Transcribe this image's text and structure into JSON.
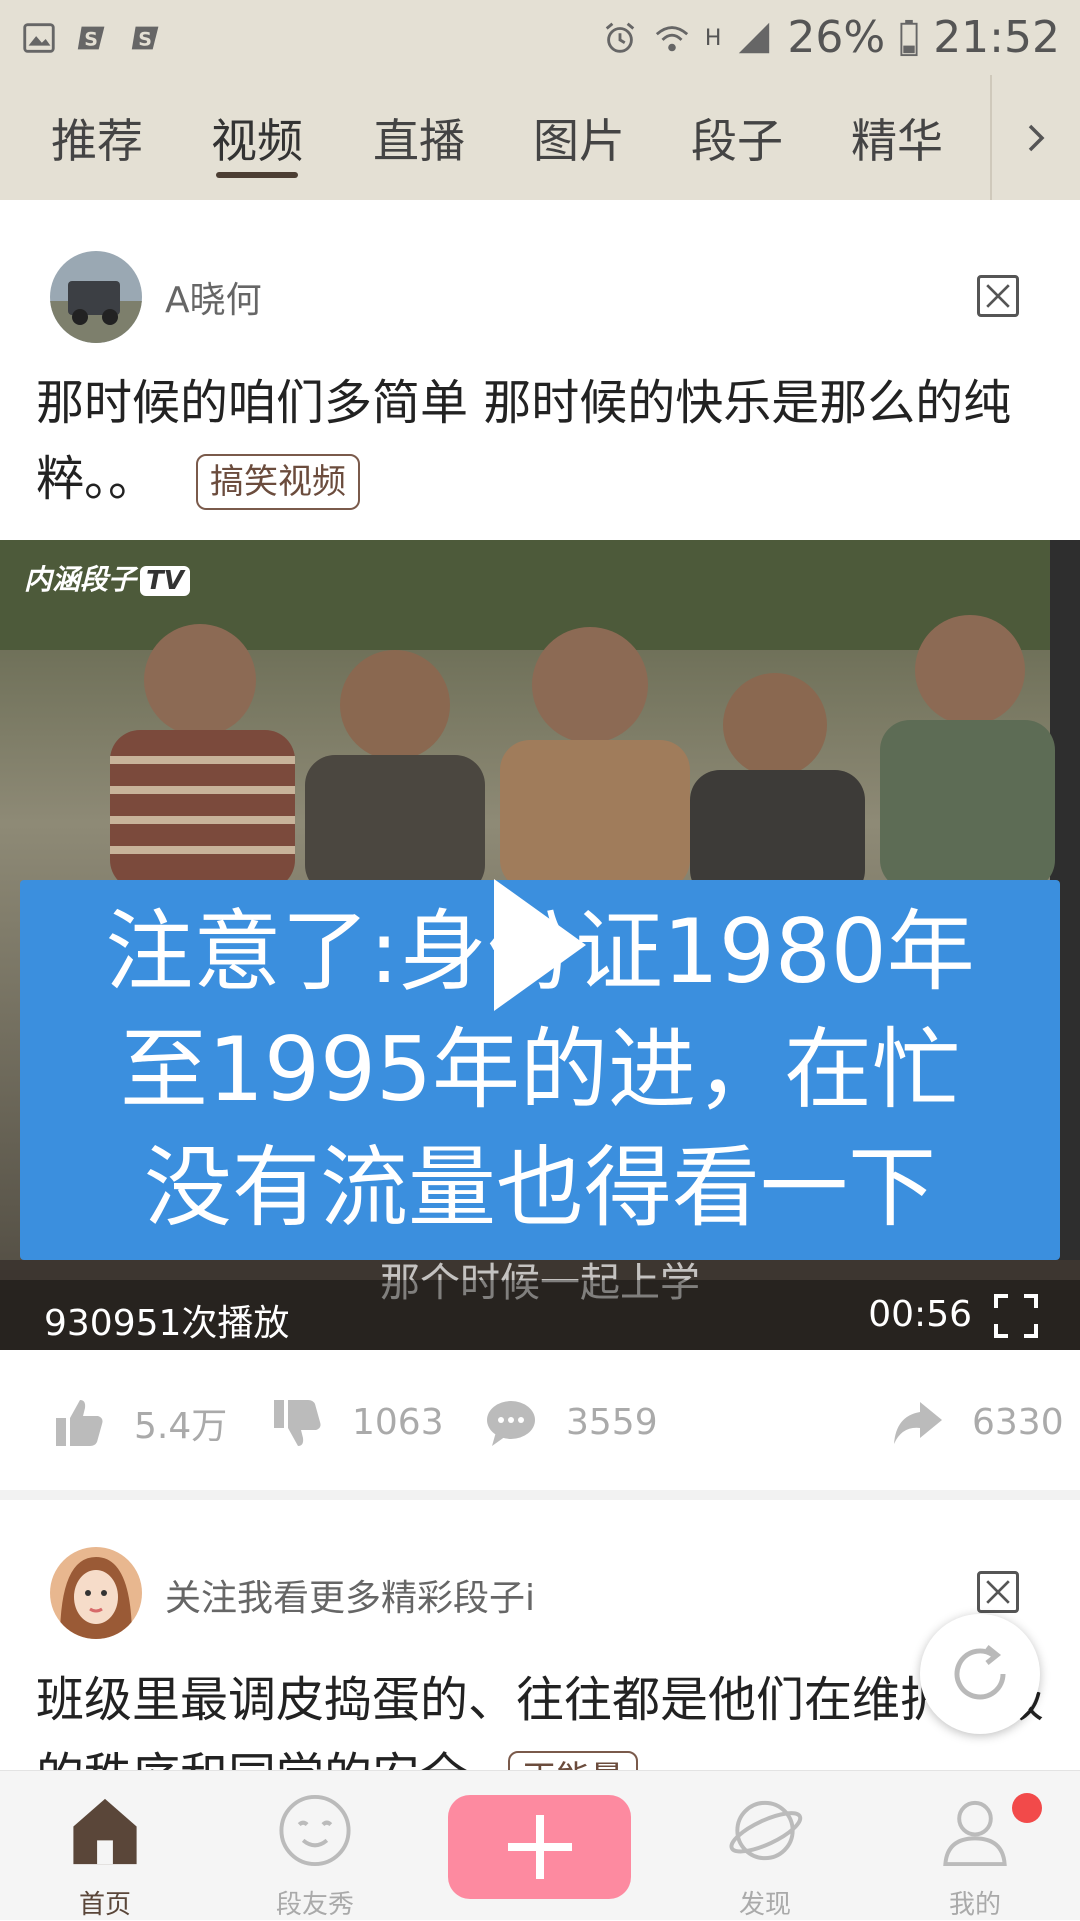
{
  "status_bar": {
    "battery": "26%",
    "time": "21:52",
    "network_type": "H",
    "icons": [
      "gallery-icon",
      "app-s-icon",
      "app-s-icon",
      "alarm-icon",
      "wifi-icon",
      "signal-icon",
      "battery-icon"
    ]
  },
  "tabs": {
    "items": [
      {
        "label": "推荐"
      },
      {
        "label": "视频",
        "active": true
      },
      {
        "label": "直播"
      },
      {
        "label": "图片"
      },
      {
        "label": "段子"
      },
      {
        "label": "精华"
      }
    ],
    "more_icon": "chevron-right-icon"
  },
  "posts": [
    {
      "username": "A晓何",
      "text": "那时候的咱们多简单 那时候的快乐是那么的纯粹。。",
      "tag": "搞笑视频",
      "video": {
        "watermark": "内涵段子",
        "watermark_badge": "TV",
        "banner_lines": [
          "注意了:身份证1980年",
          "至1995年的进，在忙",
          "没有流量也得看一下"
        ],
        "subtitle": "那个时候一起上学",
        "play_count": "930951次播放",
        "duration": "00:56"
      },
      "actions": {
        "likes": "5.4万",
        "dislikes": "1063",
        "comments": "3559",
        "shares": "6330"
      }
    },
    {
      "username": "关注我看更多精彩段子i",
      "text": "班级里最调皮捣蛋的、往往都是他们在维护班级的秩序和同学的安全",
      "tag": "正能量"
    }
  ],
  "bottom_nav": {
    "items": [
      {
        "label": "首页",
        "icon": "home-icon",
        "active": true
      },
      {
        "label": "段友秀",
        "icon": "smiley-icon"
      },
      {
        "label": "",
        "icon": "plus-icon"
      },
      {
        "label": "发现",
        "icon": "planet-icon"
      },
      {
        "label": "我的",
        "icon": "profile-icon"
      }
    ]
  },
  "colors": {
    "header_bg": "#e4e0d4",
    "tab_indicator": "#4c3e33",
    "tag_border": "#7a5a4b",
    "banner_blue": "#3b8fde",
    "publish_pink": "#fd8aa0",
    "badge_red": "#f24a4a",
    "active_nav": "#5a4639"
  }
}
